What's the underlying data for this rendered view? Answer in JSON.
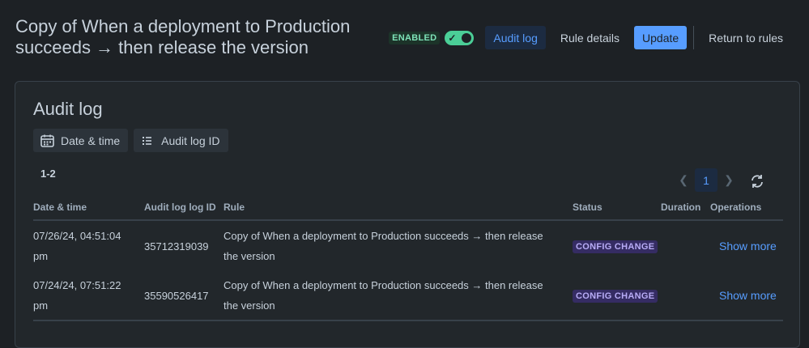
{
  "header": {
    "title": "Copy of When a deployment to Production succeeds → then release the version",
    "enabled_label": "ENABLED",
    "buttons": {
      "audit_log": "Audit log",
      "rule_details": "Rule details",
      "update": "Update",
      "return": "Return to rules"
    }
  },
  "panel": {
    "title": "Audit log",
    "filters": {
      "date_time": "Date & time",
      "audit_log_id": "Audit log ID"
    },
    "range": "1-2",
    "pagination": {
      "current_page": "1"
    },
    "columns": {
      "date_time": "Date & time",
      "audit_log_id": "Audit log log ID",
      "rule": "Rule",
      "status": "Status",
      "duration": "Duration",
      "operations": "Operations"
    },
    "rows": [
      {
        "date_line1": "07/26/24, 04:51:04",
        "date_line2": "pm",
        "id": "35712319039",
        "rule_line1": "Copy of When a deployment to Production succeeds → then release",
        "rule_line2": "the version",
        "status": "CONFIG CHANGE",
        "duration": "",
        "operation": "Show more"
      },
      {
        "date_line1": "07/24/24, 07:51:22",
        "date_line2": "pm",
        "id": "35590526417",
        "rule_line1": "Copy of When a deployment to Production succeeds → then release",
        "rule_line2": "the version",
        "status": "CONFIG CHANGE",
        "duration": "",
        "operation": "Show more"
      }
    ]
  },
  "icons": {
    "toggle": "check-icon",
    "date_filter": "calendar-icon",
    "id_filter": "list-icon",
    "prev": "chevron-left-icon",
    "next": "chevron-right-icon",
    "refresh": "refresh-icon"
  },
  "colors": {
    "background": "#1d2125",
    "panel": "#22272b",
    "accent": "#579dff",
    "enabled": "#4bce97",
    "status_purple": "#b8acf6"
  }
}
